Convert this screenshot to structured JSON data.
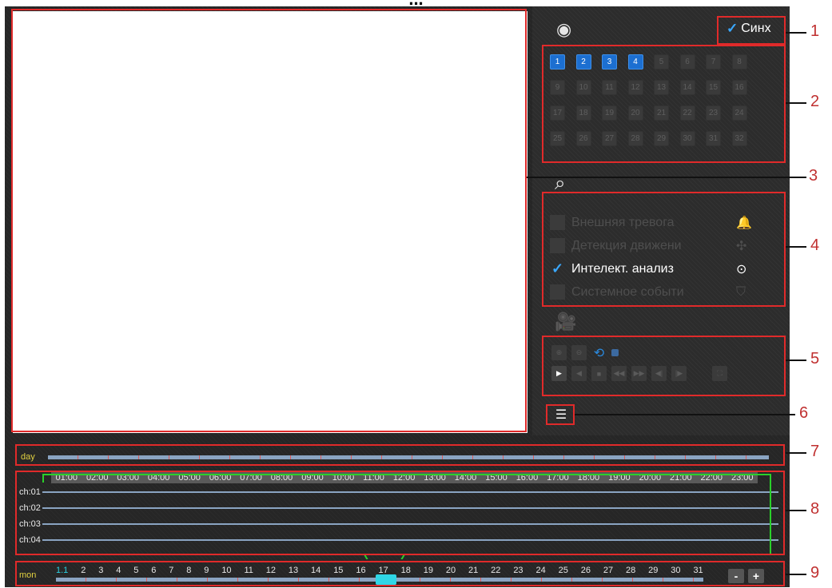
{
  "doc_title_fragment": "...",
  "sync": {
    "label": "Синх"
  },
  "channels": [
    {
      "n": "1",
      "on": true
    },
    {
      "n": "2",
      "on": true
    },
    {
      "n": "3",
      "on": true
    },
    {
      "n": "4",
      "on": true
    },
    {
      "n": "5",
      "on": false
    },
    {
      "n": "6",
      "on": false
    },
    {
      "n": "7",
      "on": false
    },
    {
      "n": "8",
      "on": false
    },
    {
      "n": "9",
      "on": false
    },
    {
      "n": "10",
      "on": false
    },
    {
      "n": "11",
      "on": false
    },
    {
      "n": "12",
      "on": false
    },
    {
      "n": "13",
      "on": false
    },
    {
      "n": "14",
      "on": false
    },
    {
      "n": "15",
      "on": false
    },
    {
      "n": "16",
      "on": false
    },
    {
      "n": "17",
      "on": false
    },
    {
      "n": "18",
      "on": false
    },
    {
      "n": "19",
      "on": false
    },
    {
      "n": "20",
      "on": false
    },
    {
      "n": "21",
      "on": false
    },
    {
      "n": "22",
      "on": false
    },
    {
      "n": "23",
      "on": false
    },
    {
      "n": "24",
      "on": false
    },
    {
      "n": "25",
      "on": false
    },
    {
      "n": "26",
      "on": false
    },
    {
      "n": "27",
      "on": false
    },
    {
      "n": "28",
      "on": false
    },
    {
      "n": "29",
      "on": false
    },
    {
      "n": "30",
      "on": false
    },
    {
      "n": "31",
      "on": false
    },
    {
      "n": "32",
      "on": false
    }
  ],
  "events": [
    {
      "label": "Внешняя тревога",
      "on": false,
      "icon": "bell-icon",
      "glyph": "🔔"
    },
    {
      "label": "Детекция движени",
      "on": false,
      "icon": "motion-icon",
      "glyph": "✣"
    },
    {
      "label": "Интелект. анализ",
      "on": true,
      "icon": "smart-analysis-icon",
      "glyph": "⊙"
    },
    {
      "label": "Системное событи",
      "on": false,
      "icon": "shield-icon",
      "glyph": "⛉"
    }
  ],
  "timeline": {
    "day_label": "day",
    "hours": [
      "01:00",
      "02:00",
      "03:00",
      "04:00",
      "05:00",
      "06:00",
      "07:00",
      "08:00",
      "09:00",
      "10:00",
      "11:00",
      "12:00",
      "13:00",
      "14:00",
      "15:00",
      "16:00",
      "17:00",
      "18:00",
      "19:00",
      "20:00",
      "21:00",
      "22:00",
      "23:00"
    ],
    "channels": [
      "ch:01",
      "ch:02",
      "ch:03",
      "ch:04"
    ]
  },
  "month": {
    "label": "mon",
    "days": [
      "1.1",
      "2",
      "3",
      "4",
      "5",
      "6",
      "7",
      "8",
      "9",
      "10",
      "11",
      "12",
      "13",
      "14",
      "15",
      "16",
      "17",
      "18",
      "19",
      "20",
      "21",
      "22",
      "23",
      "24",
      "25",
      "26",
      "27",
      "28",
      "29",
      "30",
      "31"
    ],
    "minus": "-",
    "plus": "+"
  },
  "callouts": [
    "1",
    "2",
    "3",
    "4",
    "5",
    "6",
    "7",
    "8",
    "9"
  ],
  "colors": {
    "accent": "#1c6fd1",
    "highlight": "#2fd6e6",
    "annotation": "#e02a2a",
    "timeline_ok": "#2ad02a"
  }
}
